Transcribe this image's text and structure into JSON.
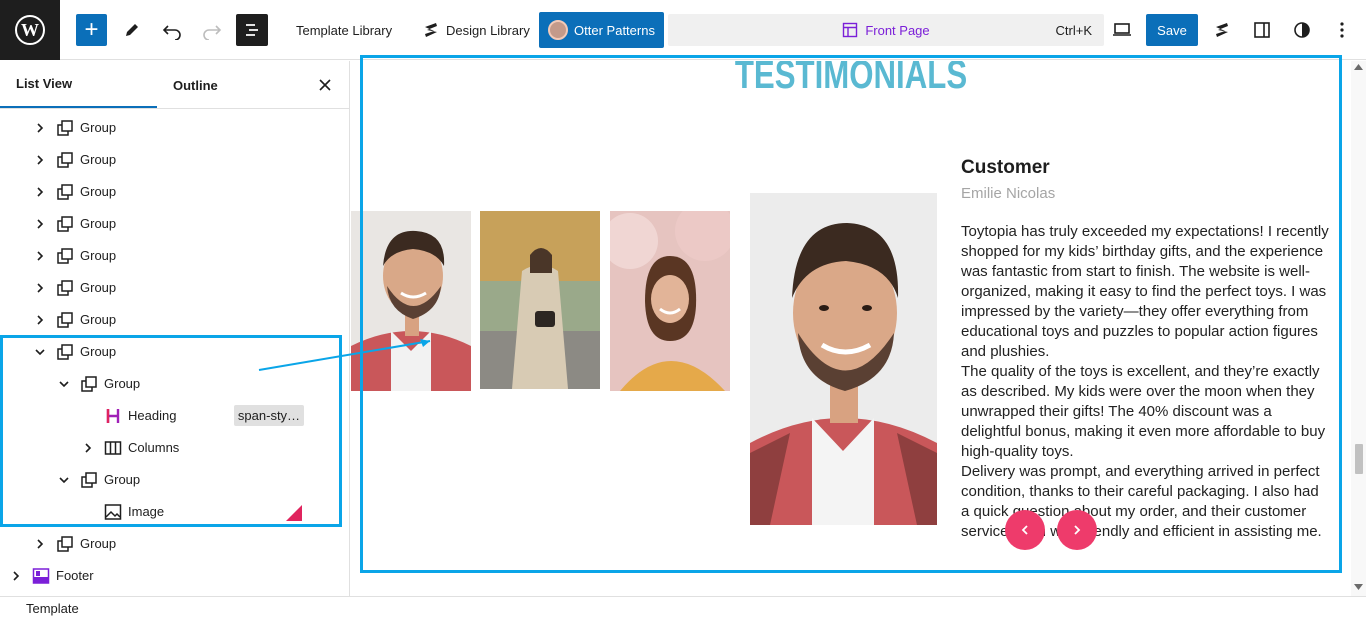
{
  "toolbar": {
    "template_library": "Template Library",
    "design_library": "Design Library",
    "otter_patterns": "Otter Patterns",
    "page_title": "Front Page",
    "shortcut": "Ctrl+K",
    "save_label": "Save"
  },
  "sidebar": {
    "tab_list_view": "List View",
    "tab_outline": "Outline",
    "items": [
      {
        "label": "Group"
      },
      {
        "label": "Group"
      },
      {
        "label": "Group"
      },
      {
        "label": "Group"
      },
      {
        "label": "Group"
      },
      {
        "label": "Group"
      },
      {
        "label": "Group"
      },
      {
        "label": "Group"
      },
      {
        "label": "Group"
      },
      {
        "label": "Heading",
        "badge": "span-sty…"
      },
      {
        "label": "Columns"
      },
      {
        "label": "Group"
      },
      {
        "label": "Image"
      },
      {
        "label": "Group"
      },
      {
        "label": "Footer"
      }
    ]
  },
  "canvas": {
    "heading": "TESTIMONIALS",
    "customer_label": "Customer",
    "customer_name": "Emilie Nicolas",
    "review_text": "Toytopia has truly exceeded my expectations! I recently shopped for my kids’ birthday gifts, and the experience was fantastic from start to finish. The website is well-organized, making it easy to find the perfect toys. I was impressed by the variety—they offer everything from educational toys and puzzles to popular action figures and plushies.\nThe quality of the toys is excellent, and they’re exactly as described. My kids were over the moon when they unwrapped their gifts! The 40% discount was a delightful bonus, making it even more affordable to buy high-quality toys.\nDelivery was prompt, and everything arrived in perfect condition, thanks to their careful packaging. I also had a quick question about my order, and their customer service team was friendly and efficient in assisting me."
  },
  "footer": {
    "breadcrumb": "Template"
  },
  "colors": {
    "accent": "#0b6fb9",
    "highlight": "#0aa5e8",
    "heading": "#5ab9d2",
    "nav_button": "#ee3b6b",
    "purple": "#7b1fd8"
  }
}
